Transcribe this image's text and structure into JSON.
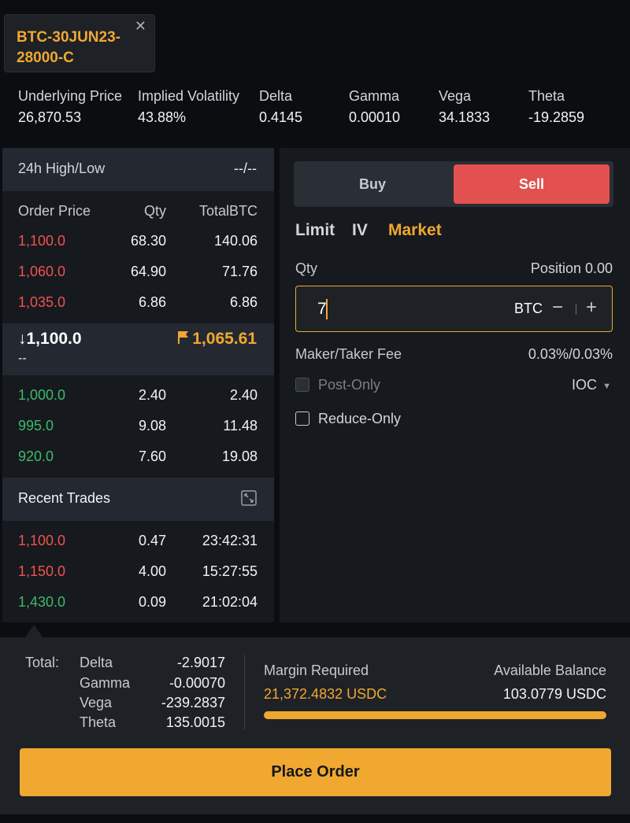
{
  "tab": {
    "title": "BTC-30JUN23-28000-C"
  },
  "greeks": [
    {
      "label": "Underlying Price",
      "value": "26,870.53"
    },
    {
      "label": "Implied Volatility",
      "value": "43.88%"
    },
    {
      "label": "Delta",
      "value": "0.4145"
    },
    {
      "label": "Gamma",
      "value": "0.00010"
    },
    {
      "label": "Vega",
      "value": "34.1833"
    },
    {
      "label": "Theta",
      "value": "-19.2859"
    }
  ],
  "orderbook": {
    "high_low_label": "24h High/Low",
    "high_low_value": "--/--",
    "headers": {
      "price": "Order Price",
      "qty": "Qty",
      "total": "TotalBTC"
    },
    "asks": [
      {
        "price": "1,100.0",
        "qty": "68.30",
        "total": "140.06"
      },
      {
        "price": "1,060.0",
        "qty": "64.90",
        "total": "71.76"
      },
      {
        "price": "1,035.0",
        "qty": "6.86",
        "total": "6.86"
      }
    ],
    "last_price": "1,100.0",
    "last_sub": "--",
    "mark_price": "1,065.61",
    "bids": [
      {
        "price": "1,000.0",
        "qty": "2.40",
        "total": "2.40"
      },
      {
        "price": "995.0",
        "qty": "9.08",
        "total": "11.48"
      },
      {
        "price": "920.0",
        "qty": "7.60",
        "total": "19.08"
      }
    ]
  },
  "recent_trades": {
    "title": "Recent Trades",
    "rows": [
      {
        "price": "1,100.0",
        "qty": "0.47",
        "time": "23:42:31",
        "side": "sell"
      },
      {
        "price": "1,150.0",
        "qty": "4.00",
        "time": "15:27:55",
        "side": "sell"
      },
      {
        "price": "1,430.0",
        "qty": "0.09",
        "time": "21:02:04",
        "side": "buy"
      }
    ]
  },
  "order_form": {
    "buy_label": "Buy",
    "sell_label": "Sell",
    "order_types": [
      "Limit",
      "IV",
      "Market"
    ],
    "active_order_type": "Market",
    "qty_label": "Qty",
    "position": "Position 0.00",
    "qty_value": "7",
    "qty_unit": "BTC",
    "fee_label": "Maker/Taker Fee",
    "fee_value": "0.03%/0.03%",
    "post_only_label": "Post-Only",
    "tif_value": "IOC",
    "reduce_only_label": "Reduce-Only"
  },
  "totals": {
    "label": "Total:",
    "rows": [
      {
        "name": "Delta",
        "value": "-2.9017"
      },
      {
        "name": "Gamma",
        "value": "-0.00070"
      },
      {
        "name": "Vega",
        "value": "-239.2837"
      },
      {
        "name": "Theta",
        "value": "135.0015"
      }
    ],
    "margin_label": "Margin Required",
    "margin_value": "21,372.4832 USDC",
    "balance_label": "Available Balance",
    "balance_value": "103.0779 USDC",
    "place_order_label": "Place Order"
  },
  "colors": {
    "accent": "#f0a830",
    "sell": "#e35050",
    "ask": "#ef5350",
    "bid": "#3fb96b"
  }
}
